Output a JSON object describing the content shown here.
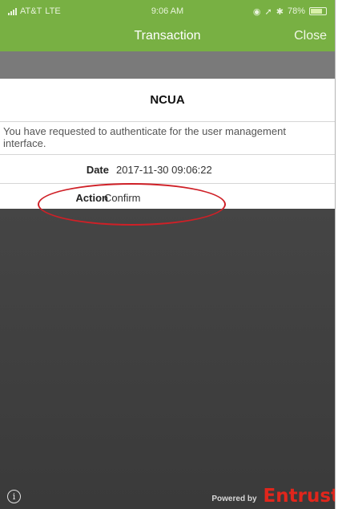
{
  "status_bar": {
    "carrier": "AT&T",
    "network": "LTE",
    "time": "9:06 AM",
    "battery_percent": "78%",
    "battery_level": 0.78,
    "icons": [
      "signal-bars-icon",
      "location-icon",
      "bluetooth-icon",
      "battery-icon"
    ]
  },
  "nav": {
    "title": "Transaction",
    "close_label": "Close"
  },
  "card": {
    "title": "NCUA",
    "message": "You have requested to authenticate for the user management interface.",
    "rows": [
      {
        "label": "Date",
        "value": "2017-11-30 09:06:22"
      },
      {
        "label": "Action",
        "value": "Confirm"
      }
    ]
  },
  "footer": {
    "info_icon": "info-icon",
    "powered_by": "Powered by",
    "brand": "Entrust"
  },
  "colors": {
    "header_green": "#78b043",
    "gray_strip": "#7a7a7a",
    "dark_background": "#424242",
    "annotation_red": "#cf2027",
    "brand_red": "#e1261c"
  }
}
